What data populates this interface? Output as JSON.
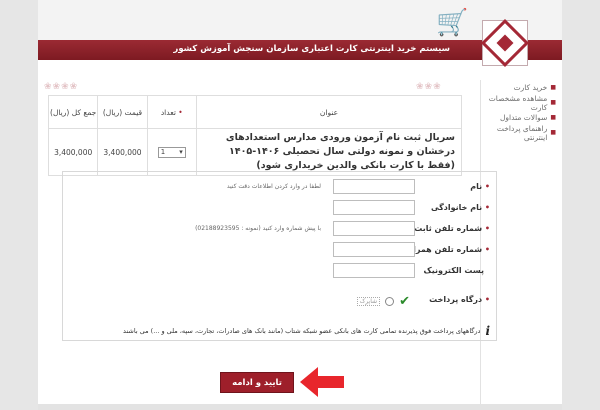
{
  "header": {
    "title": "سیستم خرید اینترنتی کارت اعتباری سازمان سنجش آموزش کشور"
  },
  "sidebar": {
    "items": [
      {
        "label": "خرید کارت"
      },
      {
        "label": "مشاهده مشخصات کارت"
      },
      {
        "label": "سوالات متداول"
      },
      {
        "label": "راهنمای پرداخت اینترنتی"
      }
    ]
  },
  "cart": {
    "headers": {
      "title": "عنوان",
      "quantity": "تعداد",
      "price": "قیمت (ریال)",
      "total": "جمع کل (ریال)"
    },
    "row": {
      "title": "سریال ثبت نام آزمون ورودی مدارس استعدادهای درخشان و نمونه دولتی سال تحصیلی ۱۴۰۶-۱۴۰۵ (فقط با کارت بانکی والدین خریداری شود)",
      "quantity": "1",
      "price": "3,400,000",
      "total": "3,400,000"
    }
  },
  "form": {
    "first_name": {
      "label": "نام",
      "value": "",
      "hint": "لطفا در وارد کردن اطلاعات دقت کنید"
    },
    "last_name": {
      "label": "نام خانوادگی",
      "value": ""
    },
    "landline": {
      "label": "شماره تلفن ثابت",
      "value": "",
      "hint": "با پیش شماره وارد کنید (نمونه : 02188923595)"
    },
    "mobile": {
      "label": "شماره تلفن همراه",
      "value": ""
    },
    "email": {
      "label": "پست الکترونیک",
      "value": ""
    },
    "gateway": {
      "label": "درگاه پرداخت",
      "logo_text": "شاپرک"
    },
    "note": "درگاههای پرداخت فوق پذیرنده تمامی کارت های بانکی عضو شبکه شتاب (مانند بانک های صادرات، تجارت، سپه، ملی و ...) می باشند"
  },
  "submit_label": "تایید و ادامه",
  "colors": {
    "brand": "#9e1f2a",
    "arrow": "#e8262c"
  }
}
